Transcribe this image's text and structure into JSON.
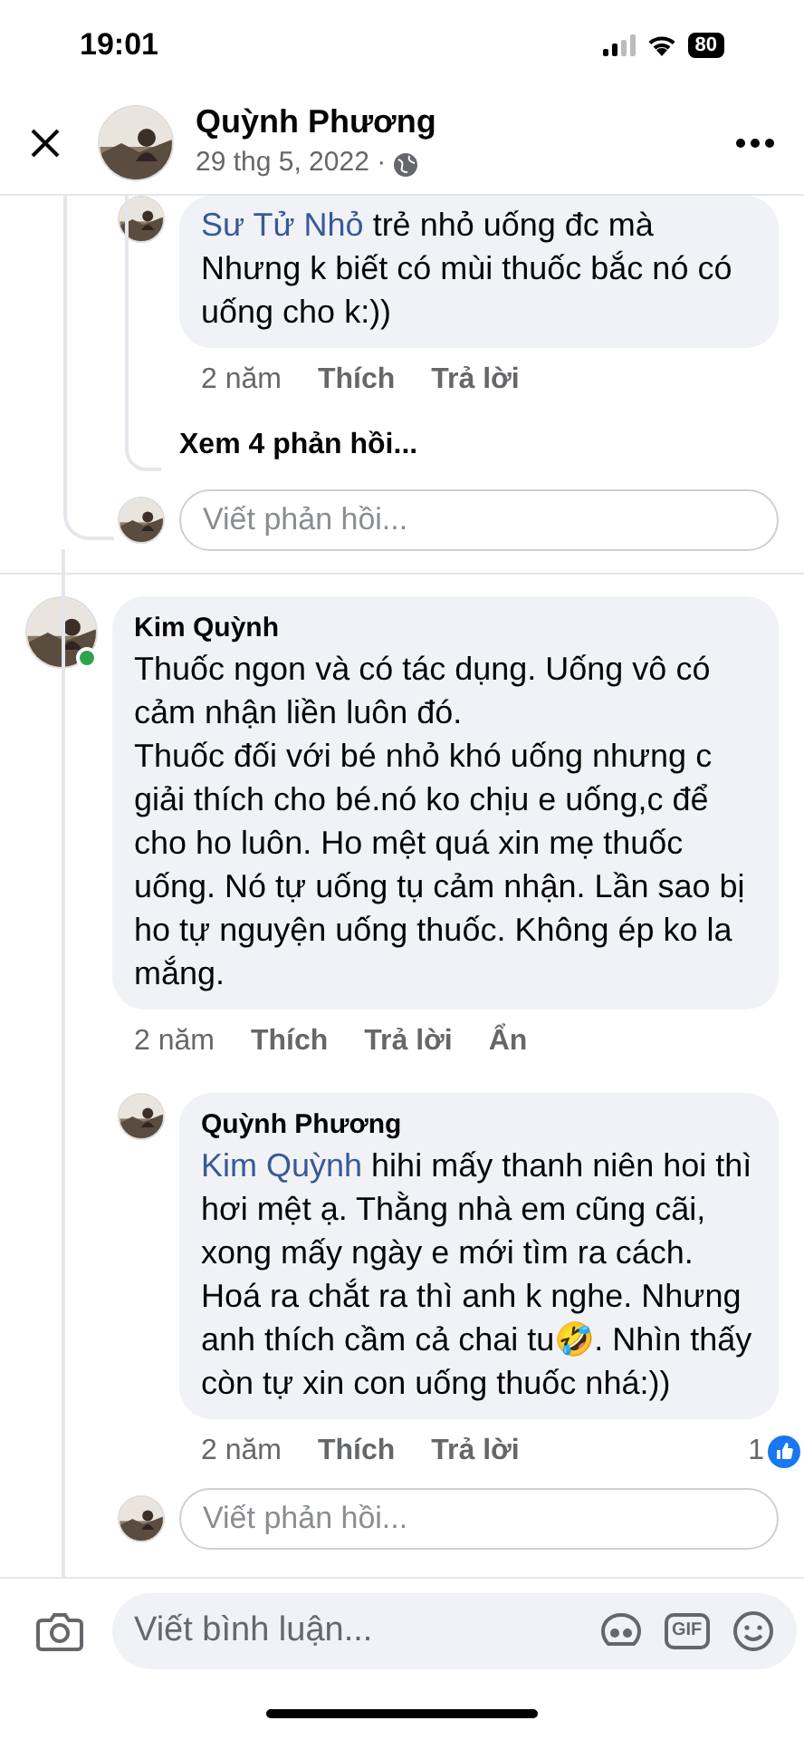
{
  "status_bar": {
    "time": "19:01",
    "battery": "80"
  },
  "header": {
    "name": "Quỳnh Phương",
    "date": "29 thg 5, 2022 ·"
  },
  "threads": [
    {
      "replies": [
        {
          "mention": "Sư Tử Nhỏ",
          "text": " trẻ nhỏ uống đc mà Nhưng k biết có mùi thuốc bắc nó có uống cho k:))",
          "time": "2 năm",
          "actions": [
            "Thích",
            "Trả lời"
          ]
        }
      ],
      "more_replies": "Xem 4 phản hồi...",
      "reply_placeholder": "Viết phản hồi..."
    },
    {
      "author": "Kim Quỳnh",
      "online": true,
      "text": "Thuốc ngon và có tác dụng. Uống vô có cảm nhận liền luôn đó.\nThuốc đối với bé nhỏ khó uống nhưng c giải thích cho bé.nó ko chịu e uống,c để cho ho luôn. Ho mệt quá xin mẹ thuốc uống. Nó tự uống tụ cảm nhận. Lần sao bị ho tự nguyện uống thuốc. Không ép ko la mắng.",
      "time": "2 năm",
      "actions": [
        "Thích",
        "Trả lời",
        "Ẩn"
      ],
      "replies": [
        {
          "author": "Quỳnh Phương",
          "mention": "Kim Quỳnh",
          "text": " hihi mấy thanh niên hoi thì hơi mệt ạ. Thằng nhà em cũng cãi, xong mấy ngày e mới tìm ra cách. Hoá ra chắt ra thì anh k nghe. Nhưng anh thích cầm cả chai tu🤣. Nhìn thấy còn tự xin con uống thuốc nhá:))",
          "time": "2 năm",
          "actions": [
            "Thích",
            "Trả lời"
          ],
          "reactions": "1"
        }
      ],
      "reply_placeholder": "Viết phản hồi..."
    }
  ],
  "composer": {
    "placeholder": "Viết bình luận...",
    "gif_label": "GIF"
  }
}
